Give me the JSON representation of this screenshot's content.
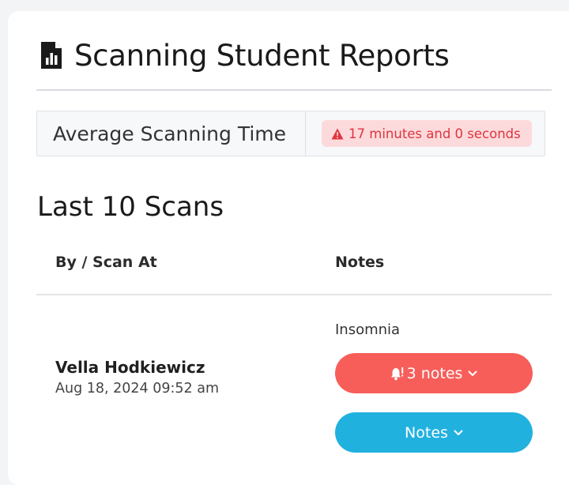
{
  "page": {
    "title": "Scanning Student Reports",
    "title_icon": "report-chart-icon"
  },
  "stats": {
    "label": "Average Scanning Time",
    "value": "17 minutes and 0 seconds",
    "value_icon": "warning-triangle-icon",
    "status_color": "#e0353f"
  },
  "scans": {
    "title": "Last 10 Scans",
    "columns": {
      "by": "By / Scan At",
      "notes": "Notes"
    },
    "rows": [
      {
        "name": "Vella Hodkiewicz",
        "scanned_at": "Aug 18, 2024 09:52 am",
        "note": "Insomnia",
        "alert_button": "3 notes",
        "alert_icon": "bell-alert-icon",
        "notes_button": "Notes"
      }
    ]
  },
  "colors": {
    "alert_button": "#f75e5a",
    "notes_button": "#21b1df",
    "badge_bg": "#fcdadc"
  }
}
